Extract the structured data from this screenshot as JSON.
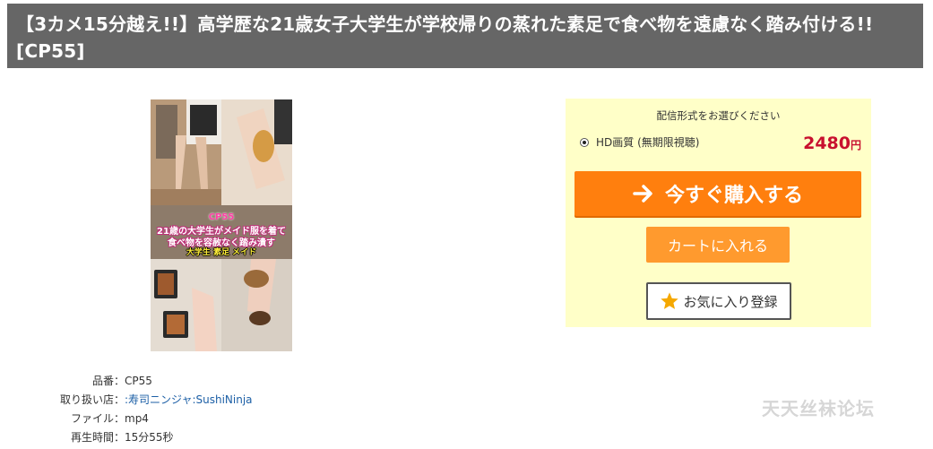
{
  "product": {
    "title": "【3カメ15分越え!!】高学歴な21歳女子大学生が学校帰りの蒸れた素足で食べ物を遠慮なく踏み付ける!! [CP55]"
  },
  "thumbnail": {
    "code": "CP55",
    "caption_line1": "21歳の大学生がメイド服を着て",
    "caption_line2": "食べ物を容赦なく踏み潰す",
    "tags": "大学生 素足 メイド"
  },
  "details": [
    {
      "label": "品番：",
      "value": "CP55",
      "is_link": false
    },
    {
      "label": "取り扱い店：",
      "value": ":寿司ニンジャ:SushiNinja",
      "is_link": true
    },
    {
      "label": "ファイル：",
      "value": "mp4",
      "is_link": false
    },
    {
      "label": "再生時間：",
      "value": "15分55秒",
      "is_link": false
    }
  ],
  "purchase": {
    "heading": "配信形式をお選びください",
    "option_label": "HD画質 (無期限視聴)",
    "option_selected": true,
    "price": "2480",
    "price_unit": "円",
    "buy_label": "今すぐ購入する",
    "cart_label": "カートに入れる",
    "favorite_label": "お気に入り登録"
  },
  "watermark": "天天丝袜论坛",
  "colors": {
    "title_bar": "#666666",
    "purchase_bg": "#ffffc8",
    "buy_button": "#ff7f0e",
    "cart_button": "#ff9a2e",
    "price": "#c8102e",
    "link": "#1c5fa6",
    "star": "#f5a800"
  },
  "icons": {
    "buy_arrow": "arrow-right-icon",
    "favorite": "star-icon"
  }
}
